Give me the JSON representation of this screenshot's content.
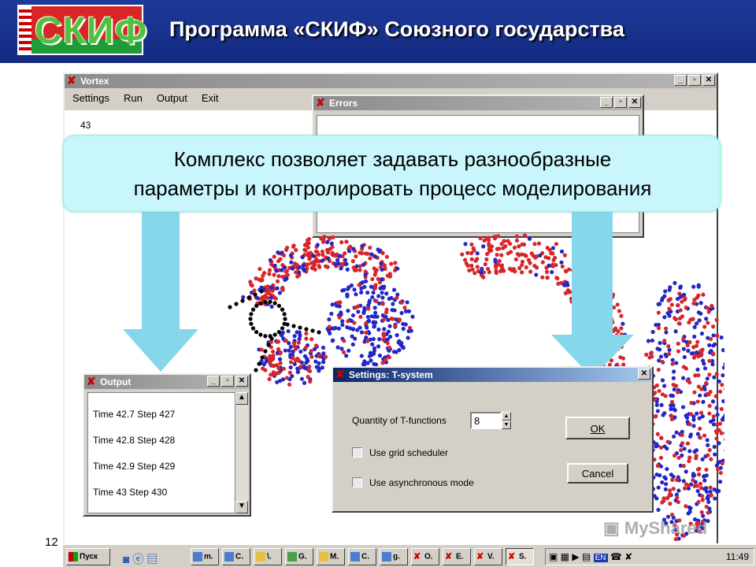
{
  "header": {
    "logo_text": "СКИФ",
    "title": "Программа «СКИФ» Союзного государства"
  },
  "vortex": {
    "title": "Vortex",
    "menu": [
      "Settings",
      "Run",
      "Output",
      "Exit"
    ],
    "value": "43"
  },
  "errors": {
    "title": "Errors"
  },
  "callout": {
    "line1": "Комплекс позволяет задавать разнообразные",
    "line2": "параметры и контролировать процесс моделирования"
  },
  "output": {
    "title": "Output",
    "lines": [
      "Time 42.7 Step 427",
      "Time 42.8 Step 428",
      "Time 42.9 Step 429",
      "Time 43 Step 430"
    ]
  },
  "settings": {
    "title": "Settings: T-system",
    "quantity_label": "Quantity of T-functions",
    "quantity_value": "8",
    "grid_label": "Use grid scheduler",
    "async_label": "Use asynchronous mode",
    "ok_label": "OK",
    "cancel_label": "Cancel"
  },
  "slide_number": "12",
  "watermark": "MyShared",
  "taskbar": {
    "start_label": "Пуск",
    "tasks": [
      "m.",
      "C.",
      "\\.",
      "G.",
      "M.",
      "C.",
      "g.",
      "O.",
      "E.",
      "V.",
      "S."
    ],
    "clock": "11:49",
    "lang": "EN"
  },
  "colors": {
    "header_bg": "#13297e",
    "callout_bg": "#c8f6fb",
    "arrow": "#87d7ec",
    "red_dots": "#d7262b",
    "blue_dots": "#2427c4"
  }
}
